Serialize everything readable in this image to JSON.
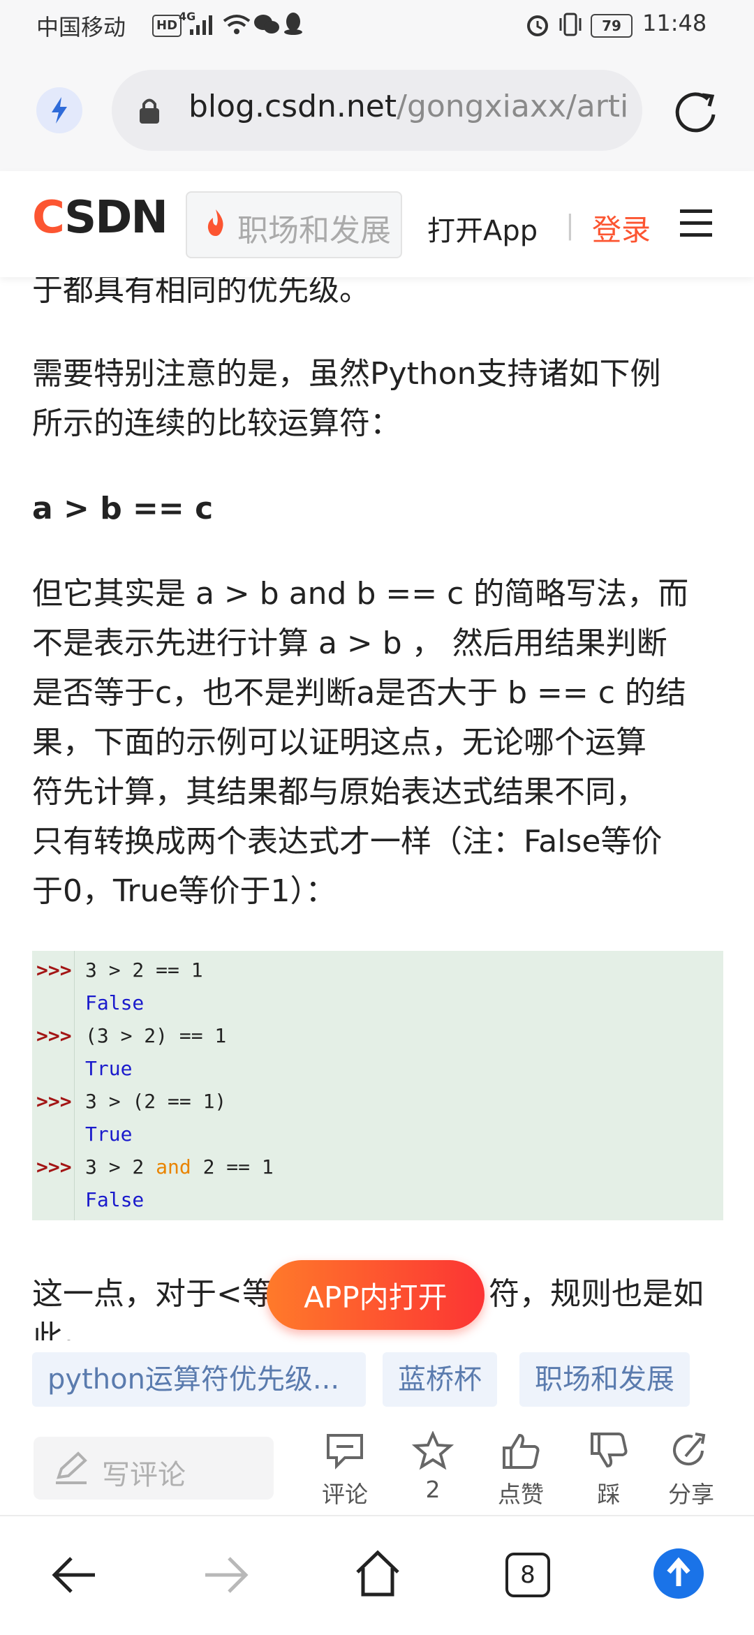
{
  "status_bar": {
    "carrier": "中国移动",
    "hd_badge": "HD",
    "network": "4G",
    "battery": "79",
    "time": "11:48"
  },
  "browser": {
    "url_host": "blog.csdn.net",
    "url_path": "/gongxiaxx/artic"
  },
  "csdn_header": {
    "logo": "CSDN",
    "search_placeholder": "职场和发展",
    "open_app": "打开App",
    "separator": "|",
    "login": "登录"
  },
  "article": {
    "p0": "于都具有相同的优先级。",
    "p1_line1": "需要特别注意的是，虽然Python支持诸如下例",
    "p1_line2": "所示的连续的比较运算符：",
    "bold_expr": "a > b == c",
    "p2_lines": [
      "但它其实是 a > b and b == c 的简略写法，而",
      "不是表示先进行计算 a > b ， 然后用结果判断",
      "是否等于c，也不是判断a是否大于 b == c 的结",
      "果，下面的示例可以证明这点，无论哪个运算",
      "符先计算，其结果都与原始表达式结果不同，",
      "只有转换成两个表达式才一样（注：False等价",
      "于0，True等价于1）："
    ],
    "p3_start": "这一点，对于<等",
    "p3_end": "符，规则也是如",
    "p3_cut": "此。"
  },
  "code_block": {
    "prompt": ">>>",
    "lines": [
      {
        "pre": "3 > 2 == 1"
      },
      {
        "out": "False"
      },
      {
        "pre": "(3 > 2) == 1"
      },
      {
        "out": "True"
      },
      {
        "pre": "3 > (2 == 1)"
      },
      {
        "out": "True"
      },
      {
        "pre": "3 > 2 ",
        "kw": "and",
        "post": " 2 == 1"
      },
      {
        "out": "False"
      }
    ]
  },
  "floating_button": "APP内打开",
  "tags": [
    "python运算符优先级...",
    "蓝桥杯",
    "职场和发展"
  ],
  "action_bar": {
    "comment_placeholder": "写评论",
    "comment": "评论",
    "favorite_count": "2",
    "like": "点赞",
    "dislike": "踩",
    "share": "分享"
  },
  "nav_bar": {
    "tabs_count": "8"
  },
  "colors": {
    "brand": "#fc5531",
    "code_bg": "#e4efe6",
    "tag_bg": "#eef3fb",
    "tag_text": "#5a7bae",
    "nav_accent": "#1a73e8"
  }
}
